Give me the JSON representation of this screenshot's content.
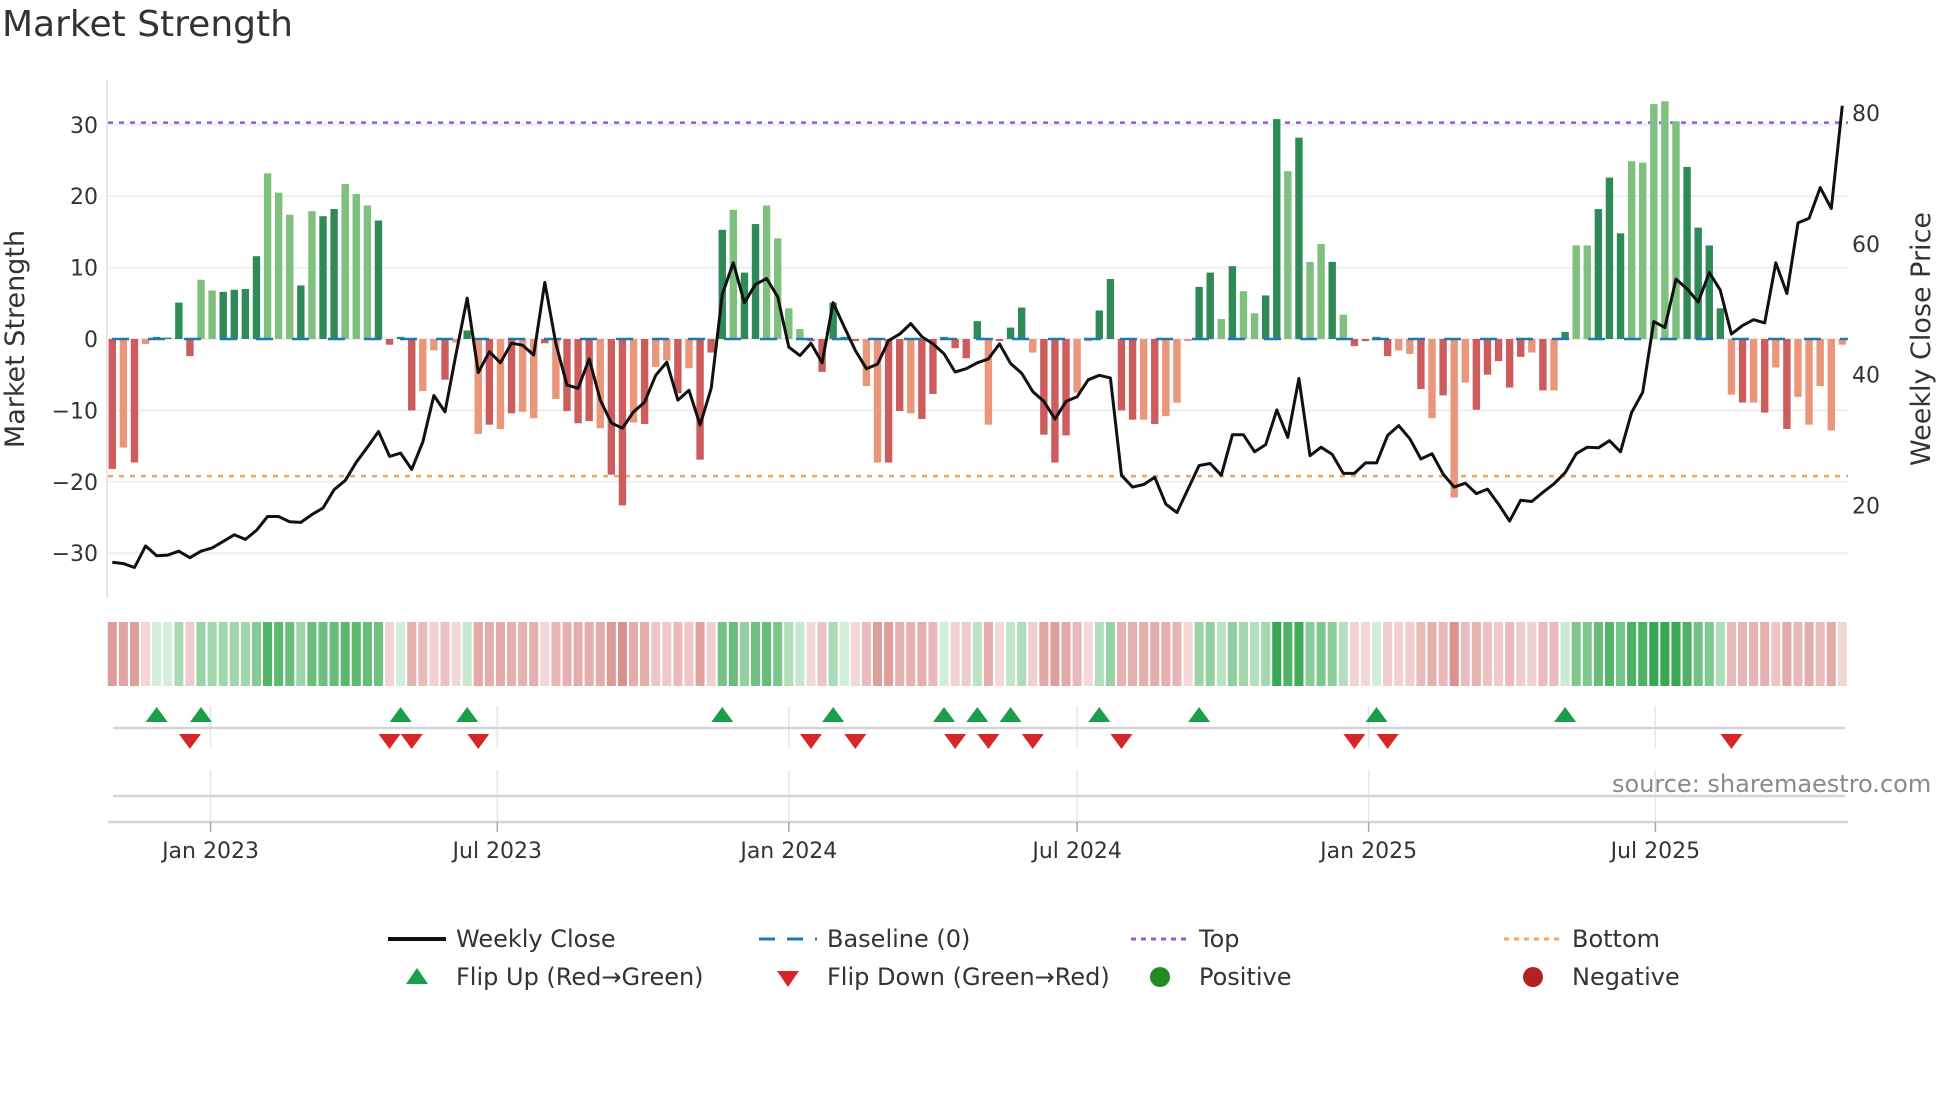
{
  "title": "Market Strength",
  "source": "source: sharemaestro.com",
  "colors": {
    "pos_dark": "#2e8b57",
    "pos_light": "#7fc07f",
    "neg_dark": "#cd5c5c",
    "neg_light": "#e9967a",
    "price": "#111111",
    "baseline": "#1f77b4",
    "top": "#9b59d6",
    "bottom": "#f4a460",
    "flip_up": "#1a9e4a",
    "flip_down": "#d62728",
    "positive": "#228b22",
    "negative": "#b22222",
    "grid": "#eceef3"
  },
  "chart_data": {
    "type": "bar+line",
    "title": "Market Strength",
    "ylabel": "Market Strength",
    "y2label": "Weekly Close Price",
    "x_start": "2022-10-31",
    "x_step_days": 7,
    "ylim": [
      -36.3,
      36.3
    ],
    "y2lim": [
      5.8,
      85.0
    ],
    "y_ticks": [
      {
        "v": 30,
        "label": "30"
      },
      {
        "v": 20,
        "label": "20"
      },
      {
        "v": 10,
        "label": "10"
      },
      {
        "v": 0,
        "label": "0"
      },
      {
        "v": -10,
        "label": "−10"
      },
      {
        "v": -20,
        "label": "−20"
      },
      {
        "v": -30,
        "label": "−30"
      }
    ],
    "y2_ticks": [
      {
        "v": 80,
        "label": "80"
      },
      {
        "v": 60,
        "label": "60"
      },
      {
        "v": 40,
        "label": "40"
      },
      {
        "v": 20,
        "label": "20"
      }
    ],
    "x_ticks": [
      {
        "date": "2023-01-01",
        "label": "Jan 2023"
      },
      {
        "date": "2023-07-01",
        "label": "Jul 2023"
      },
      {
        "date": "2024-01-01",
        "label": "Jan 2024"
      },
      {
        "date": "2024-07-01",
        "label": "Jul 2024"
      },
      {
        "date": "2025-01-01",
        "label": "Jan 2025"
      },
      {
        "date": "2025-07-01",
        "label": "Jul 2025"
      }
    ],
    "top_level": 30.3,
    "bottom_level": -19.2,
    "baseline": 0,
    "strength": [
      -18.2,
      -15.2,
      -17.3,
      -0.7,
      0.3,
      0.2,
      5.1,
      -2.4,
      8.3,
      6.8,
      6.6,
      6.9,
      7.0,
      11.6,
      23.2,
      20.5,
      17.4,
      7.5,
      17.9,
      17.2,
      18.2,
      21.7,
      20.3,
      18.7,
      16.6,
      -0.8,
      0.3,
      -10.0,
      -7.3,
      -1.6,
      -5.7,
      -0.5,
      1.2,
      -13.3,
      -12.0,
      -12.6,
      -10.4,
      -10.2,
      -11.1,
      -0.6,
      -8.4,
      -10.1,
      -11.8,
      -11.5,
      -12.5,
      -19.0,
      -23.3,
      -11.7,
      -11.9,
      -3.9,
      -3.0,
      -7.6,
      -4.1,
      -16.9,
      -1.9,
      15.3,
      18.1,
      9.3,
      16.1,
      18.7,
      14.1,
      4.3,
      1.4,
      -0.3,
      -4.6,
      5.1,
      0.3,
      -0.3,
      -6.6,
      -17.3,
      -17.3,
      -10.1,
      -10.4,
      -11.2,
      -7.7,
      0.3,
      -1.3,
      -2.7,
      2.5,
      -12.0,
      -0.3,
      1.6,
      4.4,
      -1.9,
      -13.4,
      -17.3,
      -13.5,
      -7.5,
      -0.3,
      4.0,
      8.4,
      -10.0,
      -11.3,
      -11.3,
      -11.9,
      -10.8,
      -8.9,
      -0.3,
      7.3,
      9.3,
      2.8,
      10.2,
      6.7,
      3.6,
      6.1,
      30.8,
      23.5,
      28.2,
      10.8,
      13.3,
      10.8,
      3.4,
      -1.0,
      -0.3,
      0.3,
      -2.4,
      -1.6,
      -2.1,
      -7.0,
      -11.1,
      -7.9,
      -22.2,
      -6.1,
      -9.9,
      -5.0,
      -3.1,
      -6.8,
      -2.5,
      -1.9,
      -7.2,
      -7.2,
      1.0,
      13.1,
      13.1,
      18.2,
      22.6,
      14.8,
      24.9,
      24.7,
      32.9,
      33.3,
      30.5,
      24.1,
      15.6,
      13.1,
      4.3,
      -7.8,
      -8.9,
      -8.9,
      -10.3,
      -4.0,
      -12.6,
      -8.1,
      -12.0,
      -6.6,
      -12.8,
      -0.8
    ],
    "strength_shade": "dldlddddllddddllldlddlllddddlldldldldlldldddlddldlldldddlddlllldddddllddlddddddldddldddllddddldlllddldllddldlldlddddlldldlldddddldldlldddlllllddddldldldl",
    "weekly_close": [
      11.3,
      11.1,
      10.5,
      13.8,
      12.3,
      12.4,
      13.0,
      12.0,
      13.0,
      13.5,
      14.5,
      15.5,
      14.8,
      16.2,
      18.3,
      18.3,
      17.5,
      17.4,
      18.6,
      19.6,
      22.4,
      23.8,
      26.6,
      28.9,
      31.3,
      27.5,
      28.0,
      25.5,
      29.7,
      36.8,
      34.3,
      43.2,
      51.7,
      40.3,
      43.5,
      41.8,
      44.8,
      44.5,
      43.0,
      54.1,
      44.7,
      38.4,
      37.9,
      42.4,
      36.1,
      32.6,
      31.8,
      34.3,
      35.8,
      39.9,
      41.9,
      36.1,
      37.6,
      32.3,
      37.9,
      52.3,
      57.1,
      51.0,
      53.8,
      54.7,
      51.9,
      44.2,
      42.9,
      44.8,
      41.8,
      51.0,
      47.3,
      43.7,
      40.9,
      41.6,
      45.2,
      46.2,
      47.8,
      45.8,
      44.7,
      43.2,
      40.4,
      40.9,
      41.8,
      42.4,
      44.7,
      41.7,
      40.2,
      37.4,
      35.9,
      33.2,
      35.9,
      36.6,
      39.2,
      39.9,
      39.5,
      24.6,
      22.8,
      23.2,
      24.3,
      20.2,
      18.9,
      22.5,
      26.1,
      26.4,
      24.6,
      30.8,
      30.8,
      28.2,
      29.3,
      34.6,
      30.4,
      39.4,
      27.6,
      28.9,
      27.8,
      24.9,
      24.9,
      26.5,
      26.5,
      30.7,
      32.2,
      30.2,
      27.1,
      27.9,
      24.8,
      22.8,
      23.4,
      21.8,
      22.5,
      20.2,
      17.6,
      20.8,
      20.6,
      22.0,
      23.3,
      25.0,
      27.9,
      28.9,
      28.8,
      29.9,
      28.2,
      34.2,
      37.3,
      48.1,
      47.2,
      54.6,
      53.1,
      51.1,
      55.6,
      52.9,
      46.2,
      47.5,
      48.4,
      47.9,
      57.1,
      52.4,
      63.2,
      63.9,
      68.6,
      65.4,
      81.1
    ],
    "flip_up_weeks": [
      5,
      9,
      27,
      33,
      56,
      66,
      76,
      79,
      82,
      90,
      99,
      115,
      132
    ],
    "flip_down_weeks": [
      8,
      26,
      28,
      34,
      64,
      68,
      77,
      80,
      84,
      92,
      113,
      116,
      147
    ],
    "legend": [
      {
        "key": "weekly_close",
        "label": "Weekly Close"
      },
      {
        "key": "baseline",
        "label": "Baseline (0)"
      },
      {
        "key": "top",
        "label": "Top"
      },
      {
        "key": "bottom",
        "label": "Bottom"
      },
      {
        "key": "flip_up",
        "label": "Flip Up (Red→Green)"
      },
      {
        "key": "flip_down",
        "label": "Flip Down (Green→Red)"
      },
      {
        "key": "positive",
        "label": "Positive"
      },
      {
        "key": "negative",
        "label": "Negative"
      }
    ],
    "legend_position": "bottom"
  }
}
